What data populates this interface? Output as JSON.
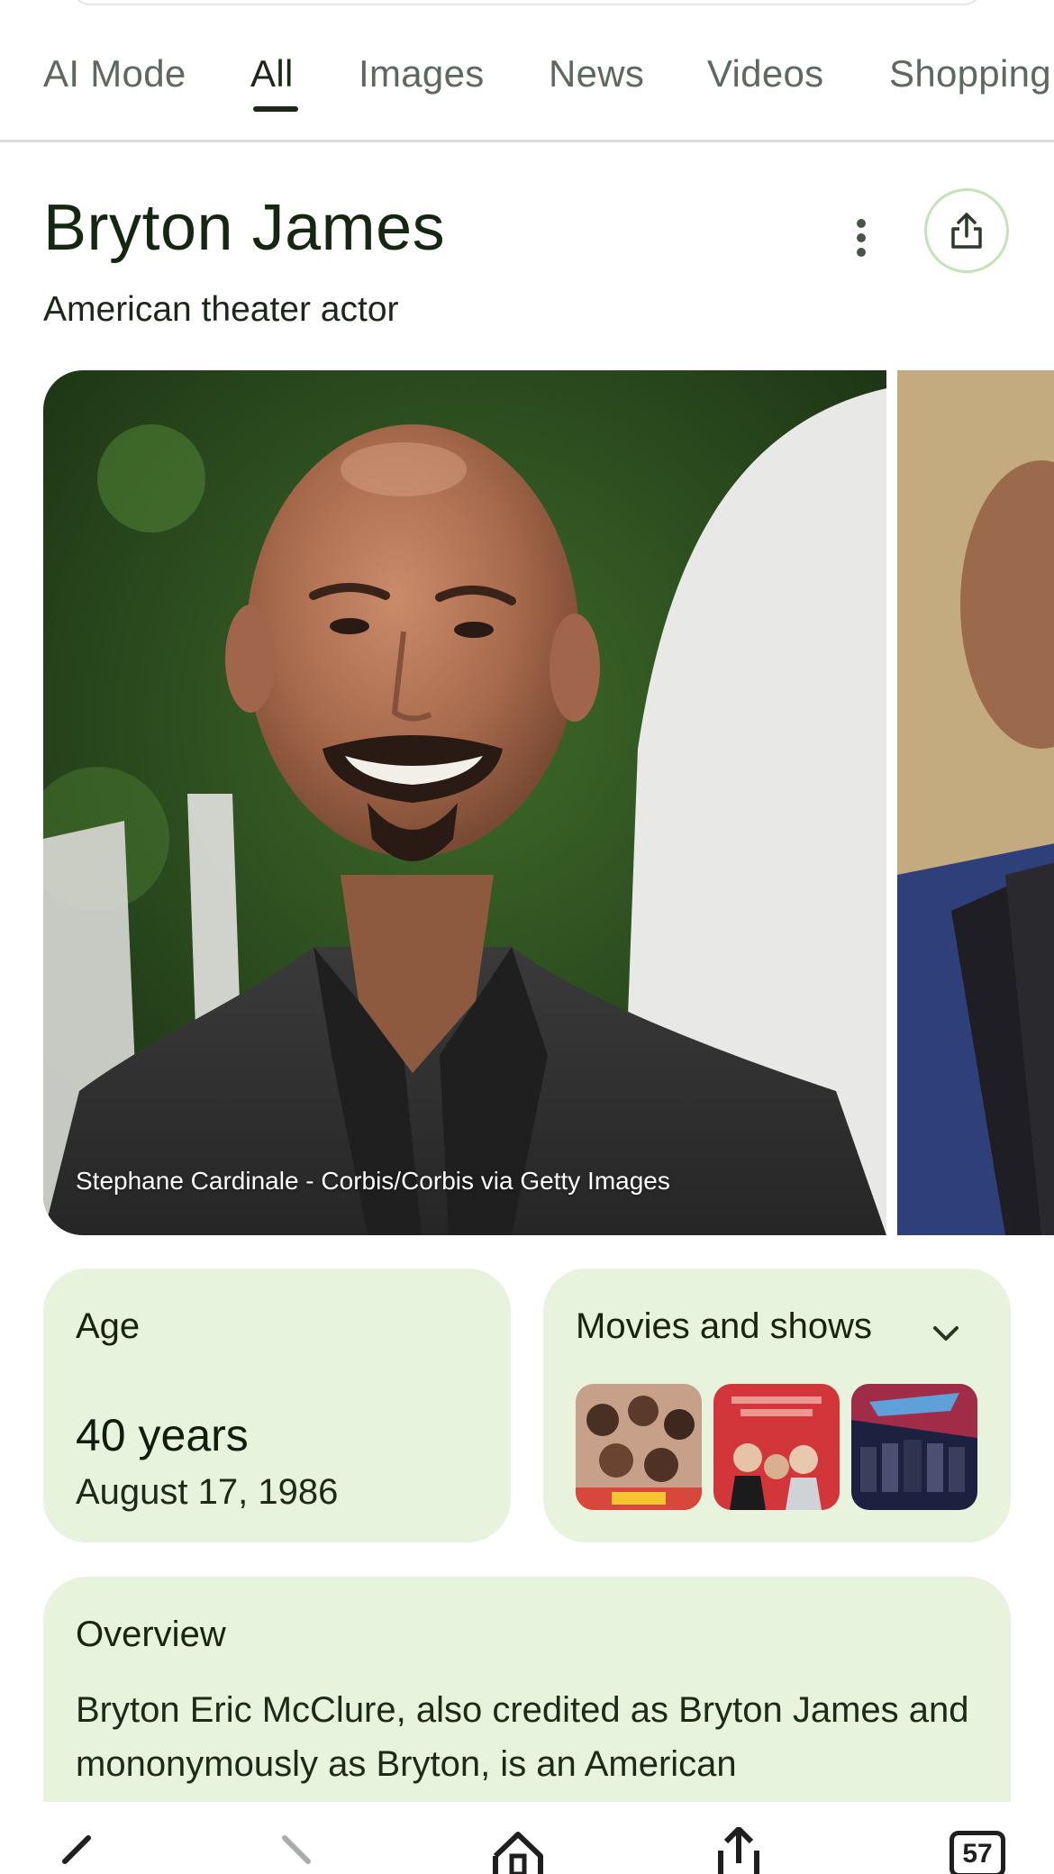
{
  "tabs": [
    {
      "label": "AI Mode"
    },
    {
      "label": "All"
    },
    {
      "label": "Images"
    },
    {
      "label": "News"
    },
    {
      "label": "Videos"
    },
    {
      "label": "Shopping"
    }
  ],
  "active_tab": "All",
  "entity": {
    "title": "Bryton James",
    "subtitle": "American theater actor",
    "photo_credit": "Stephane Cardinale - Corbis/Corbis via Getty Images"
  },
  "age_card": {
    "label": "Age",
    "value": "40 years",
    "date": "August 17, 1986"
  },
  "movies_card": {
    "label": "Movies and shows"
  },
  "overview": {
    "label": "Overview",
    "text": "Bryton Eric McClure, also credited as Bryton James and mononymously as Bryton, is an American"
  },
  "bottom_nav": {
    "tab_count": "57"
  },
  "icons": [
    "more-vert-icon",
    "share-icon",
    "chevron-down-icon",
    "back-icon",
    "forward-icon",
    "home-icon",
    "share-nav-icon",
    "tabs-icon"
  ],
  "colors": {
    "card_bg": "#e7f3dc",
    "share_border": "#bfe5b4",
    "title": "#152711"
  }
}
